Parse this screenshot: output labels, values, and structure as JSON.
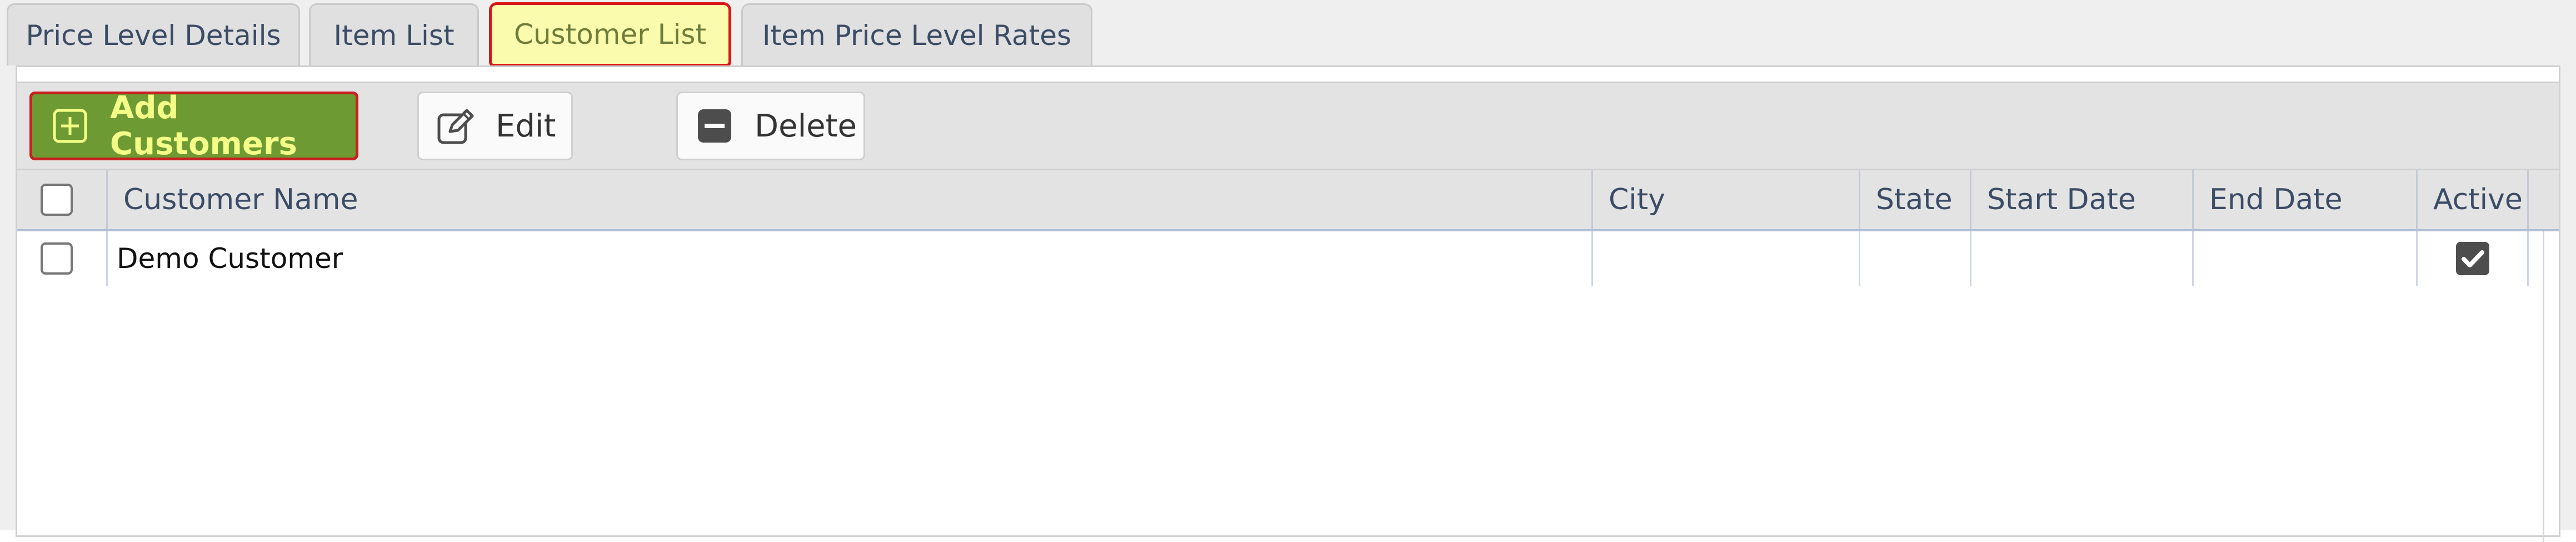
{
  "tabs": [
    {
      "label": "Price Level Details",
      "active": false
    },
    {
      "label": "Item List",
      "active": false
    },
    {
      "label": "Customer List",
      "active": true
    },
    {
      "label": "Item Price Level Rates",
      "active": false
    }
  ],
  "toolbar": {
    "add_label": "Add Customers",
    "add_icon": "plus-square-icon",
    "edit_label": "Edit",
    "edit_icon": "edit-icon",
    "delete_label": "Delete",
    "delete_icon": "minus-square-icon"
  },
  "grid": {
    "columns": [
      "Customer Name",
      "City",
      "State",
      "Start Date",
      "End Date",
      "Active"
    ],
    "rows": [
      {
        "selected": false,
        "customer_name": "Demo Customer",
        "city": "",
        "state": "",
        "start_date": "",
        "end_date": "",
        "active": true
      }
    ]
  },
  "colors": {
    "active_tab_bg": "#fbfbad",
    "active_tab_border": "#d81818",
    "add_button_bg": "#6e9a34",
    "add_button_text": "#f4ff87",
    "header_text": "#3b4c66"
  }
}
